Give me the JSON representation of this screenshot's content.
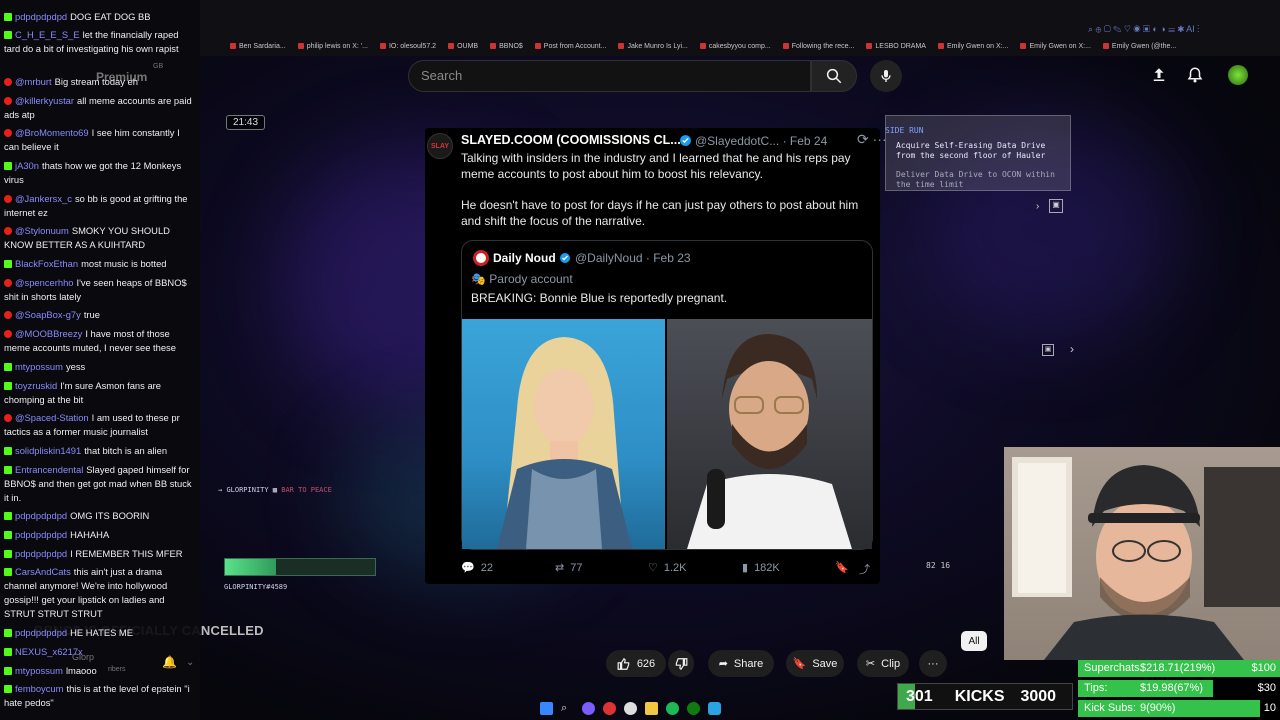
{
  "browser": {
    "bookmarks": [
      "Ben Sardaria...",
      "philip lewis on X: '...",
      "IO: olesoul57.2",
      "OUMB",
      "BBNO$",
      "Post from Account...",
      "Jake Munro Is Lyi...",
      "cakesbyyou comp...",
      "Following the rece...",
      "LESBO DRAMA",
      "Emily Gwen on X:...",
      "Emily Gwen on X:...",
      "Emily Gwen (@the..."
    ]
  },
  "header": {
    "search_placeholder": "Search",
    "search_icon": "search-icon",
    "mic_icon": "mic-icon",
    "upload_icon": "upload-icon",
    "bell_icon": "bell-icon"
  },
  "video": {
    "timestamp": "21:43",
    "title": "BBNO$ IS OFFICIALLY CANCELLED"
  },
  "tweet": {
    "name": "SLAYED.COOM (COOMISSIONS CL...",
    "handle": "@SlayeddotC...",
    "date": "· Feb 24",
    "avatar_text": "SLAY",
    "paragraph1": "Talking with insiders in the industry and I learned that he and his reps pay meme accounts to post about him to boost his relevancy.",
    "paragraph2": "He doesn't have to post for days if he can just pay others to post about him and shift the focus of the narrative.",
    "quote": {
      "name": "Daily Noud",
      "handle": "@DailyNoud · Feb 23",
      "parody": "Parody account",
      "text": "BREAKING: Bonnie Blue is reportedly pregnant."
    },
    "stats": {
      "replies": "22",
      "reposts": "77",
      "likes": "1.2K",
      "views": "182K"
    }
  },
  "game": {
    "quest_title": "SIDE RUN",
    "quest_line1": "Acquire Self-Erasing Data Drive",
    "quest_line2": "from the second floor of Hauler",
    "quest_line3": "Deliver Data Drive to OCON within",
    "quest_line4": "the time limit",
    "player_tag": "GLORPINITY",
    "player_tag2": "BAR TO PEACE",
    "player_id": "GLORPINITY#4589",
    "health": 0.34,
    "ammo_a": "82",
    "ammo_b": "16"
  },
  "actions": {
    "likes": "626",
    "share": "Share",
    "save": "Save",
    "clip": "Clip",
    "all_chip": "All"
  },
  "goals": {
    "kicks_current": "301",
    "kicks_label": "KICKS",
    "kicks_target": "3000",
    "kicks_progress": 0.1,
    "superchats_label": "Superchats:",
    "superchats_value": "$218.71(219%)",
    "superchats_target": "$100",
    "superchats_progress": 1.0,
    "tips_label": "Tips:",
    "tips_value": "$19.98(67%)",
    "tips_target": "$30",
    "tips_progress": 0.67,
    "subs_label": "Kick Subs:",
    "subs_value": "9(90%)",
    "subs_target": "10",
    "subs_progress": 0.9
  },
  "chat_overlay": {
    "premium": "Premium",
    "gb": "GB",
    "glorp": "Glorp",
    "subscribers": "ribers"
  },
  "chat": [
    {
      "platform": "kick",
      "user": "pdpdpdpdpd",
      "color": "#8b8bff",
      "text": "DOG EAT DOG BB"
    },
    {
      "platform": "kick",
      "user": "C_H_E_E_S_E",
      "color": "#8b8bff",
      "text": "let the financially raped tard do a bit of investigating his own rapist"
    },
    {
      "platform": "yt",
      "user": "@mrburt",
      "color": "#8b8bff",
      "text": "Big stream today eh"
    },
    {
      "platform": "yt",
      "user": "@killerkyustar",
      "color": "#8b8bff",
      "text": "all meme accounts are paid ads atp"
    },
    {
      "platform": "yt",
      "user": "@BroMomento69",
      "color": "#8b8bff",
      "text": "I see him constantly I can believe it"
    },
    {
      "platform": "kick",
      "user": "jA30n",
      "color": "#8b8bff",
      "text": "thats how we got the 12 Monkeys virus"
    },
    {
      "platform": "yt",
      "user": "@Jankersx_c",
      "color": "#8b8bff",
      "text": "so bb is good at grifting the internet ez"
    },
    {
      "platform": "yt",
      "user": "@Stylonuum",
      "color": "#8b8bff",
      "text": "SMOKY YOU SHOULD KNOW BETTER AS A KUIHTARD"
    },
    {
      "platform": "kick",
      "user": "BlackFoxEthan",
      "color": "#8b8bff",
      "text": "most music is botted"
    },
    {
      "platform": "yt",
      "user": "@spencerhho",
      "color": "#8b8bff",
      "text": "I've seen heaps of BBNO$ shit in shorts lately"
    },
    {
      "platform": "yt",
      "user": "@SoapBox-g7y",
      "color": "#8b8bff",
      "text": "true"
    },
    {
      "platform": "yt",
      "user": "@MOOBBreezy",
      "color": "#8b8bff",
      "text": "I have most of those meme accounts muted, I never see these"
    },
    {
      "platform": "kick",
      "user": "mtypossum",
      "color": "#8b8bff",
      "text": "yess"
    },
    {
      "platform": "kick",
      "user": "toyzruskid",
      "color": "#8b8bff",
      "text": "I'm sure Asmon fans are chomping at the bit"
    },
    {
      "platform": "yt",
      "user": "@Spaced-Station",
      "color": "#8b8bff",
      "text": "I am used to these pr tactics as a former music journalist"
    },
    {
      "platform": "kick",
      "user": "solidpliskin1491",
      "color": "#8b8bff",
      "text": "that bitch is an alien"
    },
    {
      "platform": "kick",
      "user": "Entrancendental",
      "color": "#8b8bff",
      "text": "Slayed gaped himself for BBNO$ and then get got mad when BB stuck it in."
    },
    {
      "platform": "kick",
      "user": "pdpdpdpdpd",
      "color": "#8b8bff",
      "text": "OMG ITS BOORIN"
    },
    {
      "platform": "kick",
      "user": "pdpdpdpdpd",
      "color": "#8b8bff",
      "text": "HAHAHA"
    },
    {
      "platform": "kick",
      "user": "pdpdpdpdpd",
      "color": "#8b8bff",
      "text": "I REMEMBER THIS MFER"
    },
    {
      "platform": "kick",
      "user": "CarsAndCats",
      "color": "#8b8bff",
      "text": "this ain't just a drama channel anymore! We're into hollywood gossip!!! get your lipstick on ladies and STRUT STRUT STRUT"
    },
    {
      "platform": "kick",
      "user": "pdpdpdpdpd",
      "color": "#8b8bff",
      "text": "HE HATES ME"
    },
    {
      "platform": "kick",
      "user": "NEXUS_x6217x",
      "color": "#8b8bff",
      "text": ""
    },
    {
      "platform": "kick",
      "user": "mtypossum",
      "color": "#8b8bff",
      "text": "lmaooo"
    },
    {
      "platform": "kick",
      "user": "femboycum",
      "color": "#8b8bff",
      "text": "this is at the level of epstein \"i hate pedos\""
    }
  ]
}
